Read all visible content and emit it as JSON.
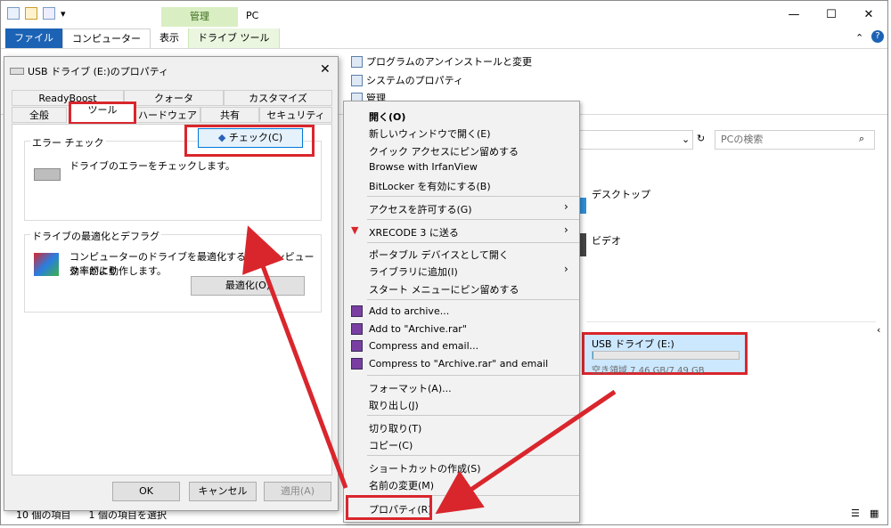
{
  "window": {
    "title": "PC",
    "manage_tab": "管理",
    "controls": {
      "minimize": "—",
      "maximize": "☐",
      "close": "✕"
    }
  },
  "ribbon": {
    "tabs": [
      "ファイル",
      "コンピューター",
      "表示",
      "ドライブ ツール"
    ],
    "items": [
      "プログラムのアンインストールと変更",
      "システムのプロパティ",
      "管理"
    ]
  },
  "search": {
    "placeholder": "PCの検索"
  },
  "right_pane": {
    "desktop": "デスクトップ",
    "video": "ビデオ",
    "usb_title": "USB ドライブ (E:)",
    "usb_free": "空き領域 7.46 GB/7.49 GB",
    "usb_used_fraction": 0.004
  },
  "status": {
    "items": "10 個の項目",
    "selected": "1 個の項目を選択"
  },
  "dialog": {
    "title": "USB ドライブ (E:)のプロパティ",
    "tabs_row1": [
      "ReadyBoost",
      "クォータ",
      "カスタマイズ"
    ],
    "tabs_row2": [
      "全般",
      "ツール",
      "ハードウェア",
      "共有",
      "セキュリティ"
    ],
    "error_group": "エラー チェック",
    "error_text": "ドライブのエラーをチェックします。",
    "check_button": "チェック(C)",
    "optimize_group": "ドライブの最適化とデフラグ",
    "optimize_text1": "コンピューターのドライブを最適化すると、コンピューターがより",
    "optimize_text2": "効率的に動作します。",
    "optimize_button": "最適化(O)",
    "ok": "OK",
    "cancel": "キャンセル",
    "apply": "適用(A)"
  },
  "context_menu": {
    "items": [
      "開く(O)",
      "新しいウィンドウで開く(E)",
      "クイック アクセスにピン留めする",
      "Browse with IrfanView",
      "BitLocker を有効にする(B)",
      "アクセスを許可する(G)",
      "XRECODE 3 に送る",
      "ポータブル デバイスとして開く",
      "ライブラリに追加(I)",
      "スタート メニューにピン留めする",
      "Add to archive...",
      "Add to \"Archive.rar\"",
      "Compress and email...",
      "Compress to \"Archive.rar\" and email",
      "フォーマット(A)...",
      "取り出し(J)",
      "切り取り(T)",
      "コピー(C)",
      "ショートカットの作成(S)",
      "名前の変更(M)",
      "プロパティ(R)"
    ]
  },
  "colors": {
    "highlight": "#d9262d",
    "file_tab": "#1c63b5",
    "manage_tab": "#d9efc3",
    "selection": "#cce8ff"
  }
}
